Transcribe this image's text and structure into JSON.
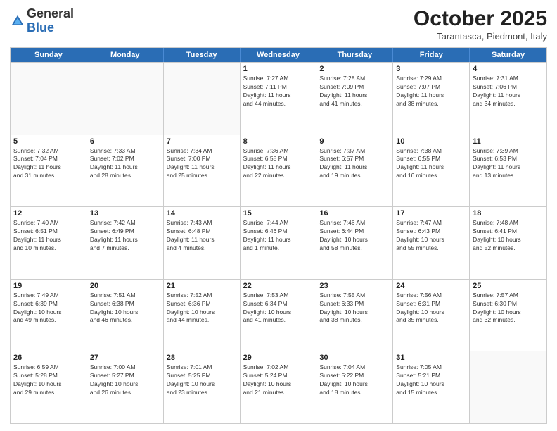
{
  "logo": {
    "general": "General",
    "blue": "Blue"
  },
  "header": {
    "month": "October 2025",
    "location": "Tarantasca, Piedmont, Italy"
  },
  "days_of_week": [
    "Sunday",
    "Monday",
    "Tuesday",
    "Wednesday",
    "Thursday",
    "Friday",
    "Saturday"
  ],
  "weeks": [
    [
      {
        "day": "",
        "info": ""
      },
      {
        "day": "",
        "info": ""
      },
      {
        "day": "",
        "info": ""
      },
      {
        "day": "1",
        "info": "Sunrise: 7:27 AM\nSunset: 7:11 PM\nDaylight: 11 hours\nand 44 minutes."
      },
      {
        "day": "2",
        "info": "Sunrise: 7:28 AM\nSunset: 7:09 PM\nDaylight: 11 hours\nand 41 minutes."
      },
      {
        "day": "3",
        "info": "Sunrise: 7:29 AM\nSunset: 7:07 PM\nDaylight: 11 hours\nand 38 minutes."
      },
      {
        "day": "4",
        "info": "Sunrise: 7:31 AM\nSunset: 7:06 PM\nDaylight: 11 hours\nand 34 minutes."
      }
    ],
    [
      {
        "day": "5",
        "info": "Sunrise: 7:32 AM\nSunset: 7:04 PM\nDaylight: 11 hours\nand 31 minutes."
      },
      {
        "day": "6",
        "info": "Sunrise: 7:33 AM\nSunset: 7:02 PM\nDaylight: 11 hours\nand 28 minutes."
      },
      {
        "day": "7",
        "info": "Sunrise: 7:34 AM\nSunset: 7:00 PM\nDaylight: 11 hours\nand 25 minutes."
      },
      {
        "day": "8",
        "info": "Sunrise: 7:36 AM\nSunset: 6:58 PM\nDaylight: 11 hours\nand 22 minutes."
      },
      {
        "day": "9",
        "info": "Sunrise: 7:37 AM\nSunset: 6:57 PM\nDaylight: 11 hours\nand 19 minutes."
      },
      {
        "day": "10",
        "info": "Sunrise: 7:38 AM\nSunset: 6:55 PM\nDaylight: 11 hours\nand 16 minutes."
      },
      {
        "day": "11",
        "info": "Sunrise: 7:39 AM\nSunset: 6:53 PM\nDaylight: 11 hours\nand 13 minutes."
      }
    ],
    [
      {
        "day": "12",
        "info": "Sunrise: 7:40 AM\nSunset: 6:51 PM\nDaylight: 11 hours\nand 10 minutes."
      },
      {
        "day": "13",
        "info": "Sunrise: 7:42 AM\nSunset: 6:49 PM\nDaylight: 11 hours\nand 7 minutes."
      },
      {
        "day": "14",
        "info": "Sunrise: 7:43 AM\nSunset: 6:48 PM\nDaylight: 11 hours\nand 4 minutes."
      },
      {
        "day": "15",
        "info": "Sunrise: 7:44 AM\nSunset: 6:46 PM\nDaylight: 11 hours\nand 1 minute."
      },
      {
        "day": "16",
        "info": "Sunrise: 7:46 AM\nSunset: 6:44 PM\nDaylight: 10 hours\nand 58 minutes."
      },
      {
        "day": "17",
        "info": "Sunrise: 7:47 AM\nSunset: 6:43 PM\nDaylight: 10 hours\nand 55 minutes."
      },
      {
        "day": "18",
        "info": "Sunrise: 7:48 AM\nSunset: 6:41 PM\nDaylight: 10 hours\nand 52 minutes."
      }
    ],
    [
      {
        "day": "19",
        "info": "Sunrise: 7:49 AM\nSunset: 6:39 PM\nDaylight: 10 hours\nand 49 minutes."
      },
      {
        "day": "20",
        "info": "Sunrise: 7:51 AM\nSunset: 6:38 PM\nDaylight: 10 hours\nand 46 minutes."
      },
      {
        "day": "21",
        "info": "Sunrise: 7:52 AM\nSunset: 6:36 PM\nDaylight: 10 hours\nand 44 minutes."
      },
      {
        "day": "22",
        "info": "Sunrise: 7:53 AM\nSunset: 6:34 PM\nDaylight: 10 hours\nand 41 minutes."
      },
      {
        "day": "23",
        "info": "Sunrise: 7:55 AM\nSunset: 6:33 PM\nDaylight: 10 hours\nand 38 minutes."
      },
      {
        "day": "24",
        "info": "Sunrise: 7:56 AM\nSunset: 6:31 PM\nDaylight: 10 hours\nand 35 minutes."
      },
      {
        "day": "25",
        "info": "Sunrise: 7:57 AM\nSunset: 6:30 PM\nDaylight: 10 hours\nand 32 minutes."
      }
    ],
    [
      {
        "day": "26",
        "info": "Sunrise: 6:59 AM\nSunset: 5:28 PM\nDaylight: 10 hours\nand 29 minutes."
      },
      {
        "day": "27",
        "info": "Sunrise: 7:00 AM\nSunset: 5:27 PM\nDaylight: 10 hours\nand 26 minutes."
      },
      {
        "day": "28",
        "info": "Sunrise: 7:01 AM\nSunset: 5:25 PM\nDaylight: 10 hours\nand 23 minutes."
      },
      {
        "day": "29",
        "info": "Sunrise: 7:02 AM\nSunset: 5:24 PM\nDaylight: 10 hours\nand 21 minutes."
      },
      {
        "day": "30",
        "info": "Sunrise: 7:04 AM\nSunset: 5:22 PM\nDaylight: 10 hours\nand 18 minutes."
      },
      {
        "day": "31",
        "info": "Sunrise: 7:05 AM\nSunset: 5:21 PM\nDaylight: 10 hours\nand 15 minutes."
      },
      {
        "day": "",
        "info": ""
      }
    ]
  ]
}
